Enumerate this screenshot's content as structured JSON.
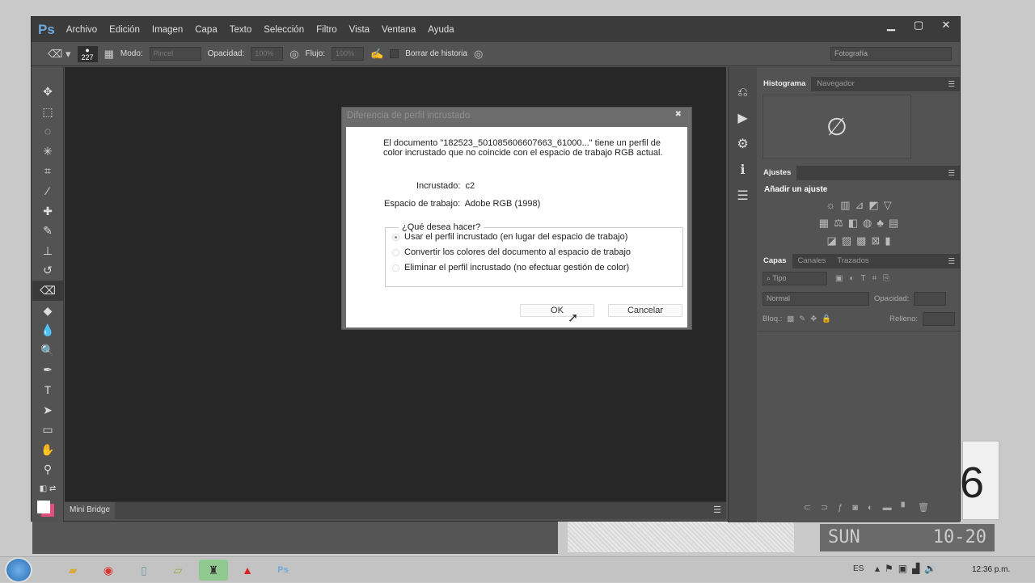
{
  "app": {
    "logo": "Ps",
    "menu": [
      "Archivo",
      "Edición",
      "Imagen",
      "Capa",
      "Texto",
      "Selección",
      "Filtro",
      "Vista",
      "Ventana",
      "Ayuda"
    ],
    "window_controls": [
      "minimize",
      "maximize",
      "close"
    ]
  },
  "options": {
    "brush_size": "227",
    "mode_label": "Modo:",
    "mode_value": "Pincel",
    "opacity_label": "Opacidad:",
    "opacity_value": "100%",
    "flow_label": "Flujo:",
    "flow_value": "100%",
    "erase_history": "Borrar de historia",
    "workspace": "Fotografía"
  },
  "tools": [
    "move",
    "marquee",
    "lasso",
    "quick-select",
    "crop",
    "eyedropper",
    "healing",
    "brush",
    "stamp",
    "history-brush",
    "eraser",
    "paint-bucket",
    "blur",
    "dodge",
    "pen",
    "type",
    "path-select",
    "shape",
    "hand",
    "zoom"
  ],
  "minibridge": {
    "label": "Mini Bridge"
  },
  "panels": {
    "histogram_tabs": [
      "Histograma",
      "Navegador"
    ],
    "adjust_tab": "Ajustes",
    "adjust_title": "Añadir un ajuste",
    "layers_tabs": [
      "Capas",
      "Canales",
      "Trazados"
    ],
    "filter": "Tipo",
    "blend": "Normal",
    "opacity_label": "Opacidad:",
    "lock_label": "Bloq.:",
    "fill_label": "Relleno:"
  },
  "dialog": {
    "title": "Diferencia de perfil incrustado",
    "message": "El documento \"182523_501085606607663_61000...\" tiene un perfil de color incrustado que no coincide con el espacio de trabajo RGB actual.",
    "embedded_label": "Incrustado:",
    "embedded_value": "c2",
    "workspace_label": "Espacio de trabajo:",
    "workspace_value": "Adobe RGB (1998)",
    "group_label": "¿Qué desea hacer?",
    "options": [
      "Usar el perfil incrustado (en lugar del espacio de trabajo)",
      "Convertir los colores del documento al espacio de trabajo",
      "Eliminar el perfil incrustado (no efectuar gestión de color)"
    ],
    "selected_option": 0,
    "ok": "OK",
    "cancel": "Cancelar"
  },
  "desktop": {
    "clock_day": "SUN",
    "clock_date": "10-20",
    "clock_digit": "6"
  },
  "taskbar": {
    "apps": [
      "explorer",
      "chrome",
      "notepad",
      "notes",
      "app",
      "acrobat",
      "photoshop"
    ],
    "lang": "ES",
    "time": "12:36 p.m."
  }
}
